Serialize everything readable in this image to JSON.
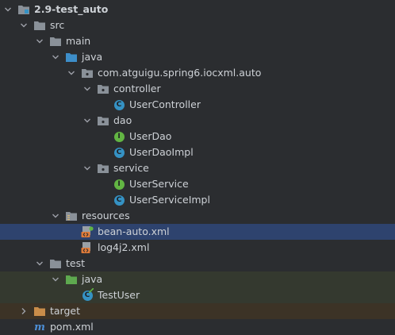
{
  "project_tree": {
    "root": {
      "name": "2.9-test_auto"
    },
    "src": "src",
    "main": "main",
    "main_java": "java",
    "package": "com.atguigu.spring6.iocxml.auto",
    "controller_pkg": "controller",
    "user_controller": "UserController",
    "dao_pkg": "dao",
    "user_dao": "UserDao",
    "user_dao_impl": "UserDaoImpl",
    "service_pkg": "service",
    "user_service": "UserService",
    "user_service_impl": "UserServiceImpl",
    "resources": "resources",
    "bean_auto": "bean-auto.xml",
    "log4j2": "log4j2.xml",
    "test": "test",
    "test_java": "java",
    "test_user": "TestUser",
    "target": "target",
    "pom": "pom.xml",
    "class_badge": "C",
    "interface_badge": "I",
    "maven_badge": "m"
  },
  "colors": {
    "background": "#2b2d30",
    "selected_row": "#2e436e",
    "test_source_row": "#34392f",
    "excluded_row": "#3c3326",
    "class_icon": "#3592c4",
    "interface_icon": "#62b543"
  }
}
